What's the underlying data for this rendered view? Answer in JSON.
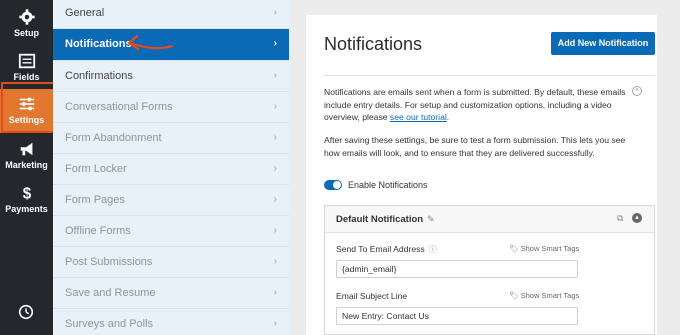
{
  "rail": {
    "items": [
      {
        "label": "Setup",
        "icon": "gear-icon"
      },
      {
        "label": "Fields",
        "icon": "fields-icon"
      },
      {
        "label": "Settings",
        "icon": "sliders-icon",
        "active": true
      },
      {
        "label": "Marketing",
        "icon": "megaphone-icon"
      },
      {
        "label": "Payments",
        "icon": "dollar-icon"
      }
    ],
    "bottom_icon": "history-icon"
  },
  "submenu": {
    "items": [
      {
        "label": "General"
      },
      {
        "label": "Notifications",
        "active": true
      },
      {
        "label": "Confirmations"
      },
      {
        "label": "Conversational Forms"
      },
      {
        "label": "Form Abandonment"
      },
      {
        "label": "Form Locker"
      },
      {
        "label": "Form Pages"
      },
      {
        "label": "Offline Forms"
      },
      {
        "label": "Post Submissions"
      },
      {
        "label": "Save and Resume"
      },
      {
        "label": "Surveys and Polls"
      }
    ]
  },
  "main": {
    "title": "Notifications",
    "add_button": "Add New Notification",
    "intro": {
      "text": "Notifications are emails sent when a form is submitted. By default, these emails include entry details. For setup and customization options, including a video overview, please ",
      "link": "see our tutorial",
      "end": "."
    },
    "after": {
      "part1": "After saving these settings, be sure to ",
      "link1": "test a form submission",
      "part2": ". This lets you see how emails will look, and to ensure that they ",
      "link2": "are delivered successfully",
      "part3": "."
    },
    "toggle_label": "Enable Notifications",
    "notification": {
      "title": "Default Notification",
      "send_to_label": "Send To Email Address",
      "send_to_value": "{admin_email}",
      "subject_label": "Email Subject Line",
      "subject_value": "New Entry: Contact Us",
      "smart_tags": "Show Smart Tags"
    }
  },
  "colors": {
    "accent": "#0a6ab6",
    "rail_active": "#e27730",
    "annotation": "#e8481e"
  }
}
